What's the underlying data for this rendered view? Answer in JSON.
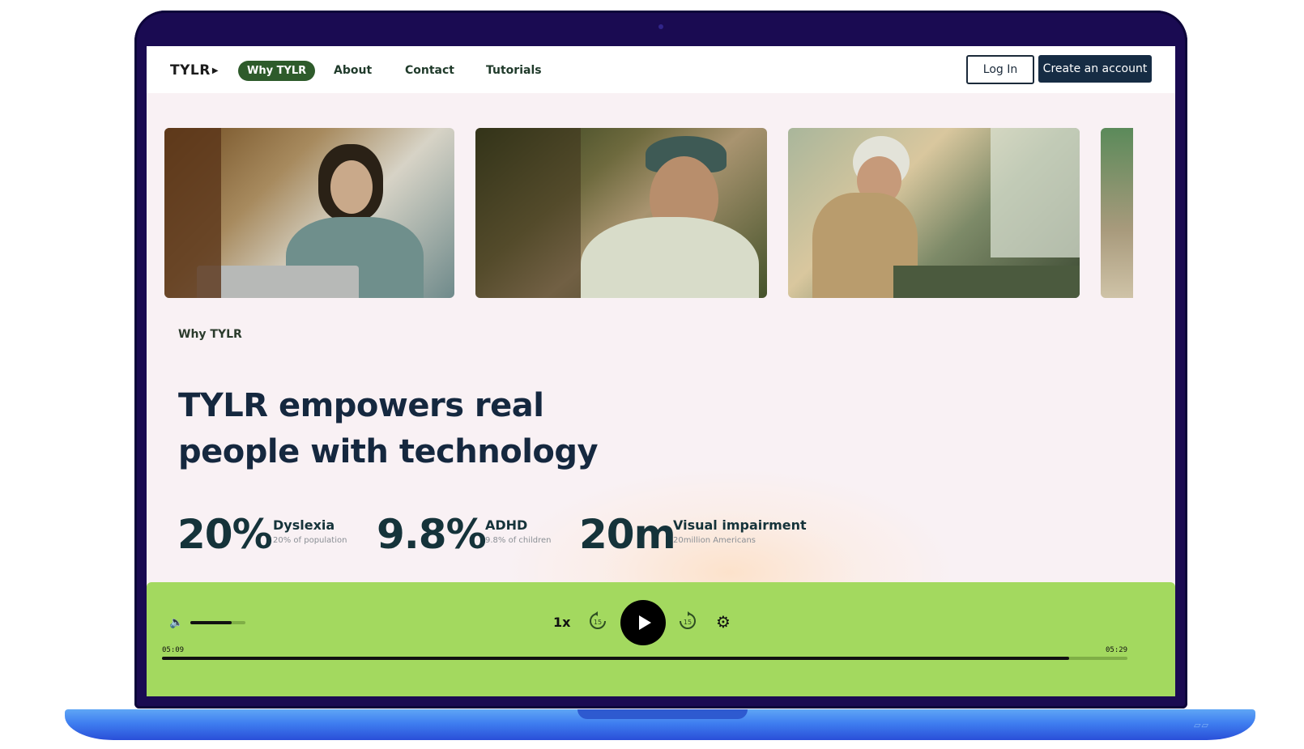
{
  "nav": {
    "logo": "TYLR",
    "links": [
      {
        "label": "Why TYLR",
        "active": true
      },
      {
        "label": "About"
      },
      {
        "label": "Contact"
      },
      {
        "label": "Tutorials"
      }
    ],
    "login_label": "Log In",
    "create_label": "Create an account"
  },
  "carousel": {
    "photos": [
      "woman-with-headphones-at-laptop",
      "smiling-man-in-cap",
      "elderly-woman-at-kitchen-sink",
      "partial-outdoor-photo"
    ]
  },
  "hero": {
    "eyebrow": "Why TYLR",
    "headline_line1": "TYLR empowers real",
    "headline_line2": "people with technology"
  },
  "stats": [
    {
      "value": "20%",
      "label": "Dyslexia",
      "sub": "20% of population"
    },
    {
      "value": "9.8%",
      "label": "ADHD",
      "sub": "9.8% of children"
    },
    {
      "value": "20m",
      "label": "Visual impairment",
      "sub": "20million Americans"
    }
  ],
  "player": {
    "speed": "1x",
    "skip_back": "15",
    "skip_forward": "15",
    "elapsed": "05:09",
    "duration": "05:29",
    "volume_fraction": 0.75,
    "progress_fraction": 0.94,
    "icons": [
      "volume-icon",
      "rewind-15-icon",
      "play-icon",
      "forward-15-icon",
      "gear-icon"
    ],
    "accent_color": "#a3d95f"
  },
  "colors": {
    "brand_green": "#2e5b2b",
    "navy": "#162c44",
    "laptop_frame": "#1a0b52",
    "laptop_base": "#3f7ef0"
  }
}
